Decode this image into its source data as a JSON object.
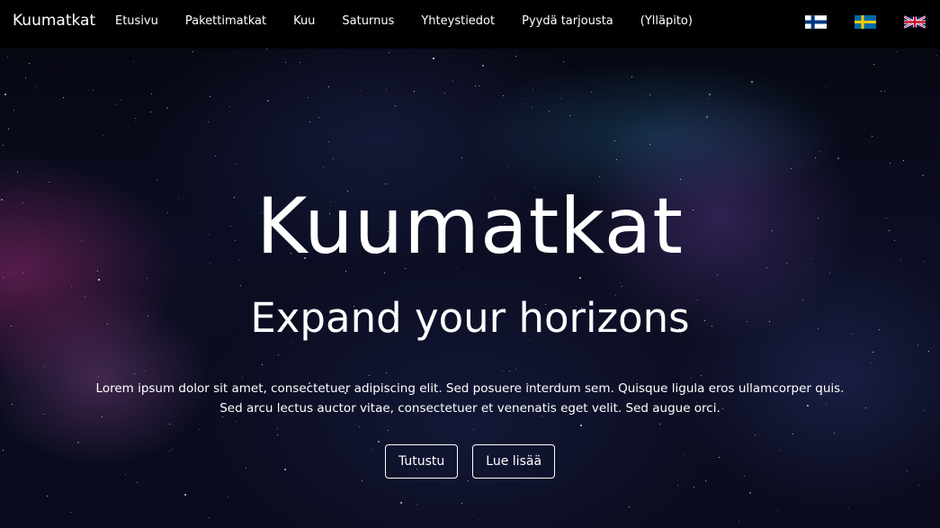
{
  "navbar": {
    "brand": "Kuumatkat",
    "links": [
      {
        "label": "Etusivu"
      },
      {
        "label": "Pakettimatkat"
      },
      {
        "label": "Kuu"
      },
      {
        "label": "Saturnus"
      },
      {
        "label": "Yhteystiedot"
      },
      {
        "label": "Pyydä tarjousta"
      },
      {
        "label": "(Ylläpito)"
      }
    ],
    "flags": [
      "finland-flag-icon",
      "sweden-flag-icon",
      "uk-flag-icon"
    ]
  },
  "hero": {
    "title": "Kuumatkat",
    "subtitle": "Expand your horizons",
    "text_line1": "Lorem ipsum dolor sit amet, consectetuer adipiscing elit. Sed posuere interdum sem. Quisque ligula eros ullamcorper quis.",
    "text_line2": "Sed arcu lectus auctor vitae, consectetuer et venenatis eget velit. Sed augue orci.",
    "buttons": {
      "primary_label": "Tutustu",
      "secondary_label": "Lue lisää"
    }
  },
  "colors": {
    "navbar_bg": "#000000",
    "text": "#ffffff",
    "finland_blue": "#003580",
    "sweden_blue": "#006aa7",
    "sweden_yellow": "#fecc00",
    "uk_blue": "#012169",
    "uk_red": "#c8102e"
  }
}
